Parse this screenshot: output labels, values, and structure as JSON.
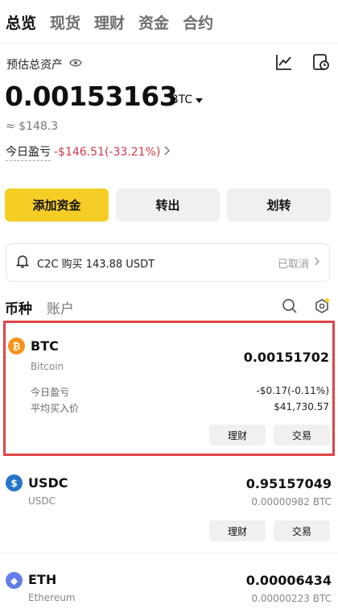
{
  "tabs": [
    "总览",
    "现货",
    "理财",
    "资金",
    "合约"
  ],
  "estimate": {
    "label": "预估总资产",
    "total": "0.00153163",
    "unit": "BTC",
    "approx": "≈ $148.3"
  },
  "pnl": {
    "label": "今日盈亏",
    "value": "-$146.51(-33.21%)"
  },
  "buttons": {
    "add": "添加资金",
    "withdraw": "转出",
    "transfer": "划转"
  },
  "c2c": {
    "text": "C2C 购买 143.88 USDT",
    "status": "已取消"
  },
  "sub_tabs": {
    "coins": "币种",
    "accounts": "账户"
  },
  "assets": [
    {
      "symbol": "BTC",
      "name": "Bitcoin",
      "amount": "0.00151702",
      "pnl_label": "今日盈亏",
      "pnl_value": "-$0.17(-0.11%)",
      "avg_label": "平均买入价",
      "avg_value": "$41,730.57",
      "earn": "理财",
      "trade": "交易",
      "color": "#f7931a"
    },
    {
      "symbol": "USDC",
      "name": "USDC",
      "amount": "0.95157049",
      "btc_value": "0.00000982 BTC",
      "earn": "理财",
      "trade": "交易",
      "color": "#2775ca"
    },
    {
      "symbol": "ETH",
      "name": "Ethereum",
      "amount": "0.00006434",
      "btc_value": "0.00000223 BTC",
      "color": "#627eea"
    }
  ],
  "colors": {
    "accent": "#f6cd25",
    "negative": "#d0384b",
    "selection": "#e04545"
  }
}
